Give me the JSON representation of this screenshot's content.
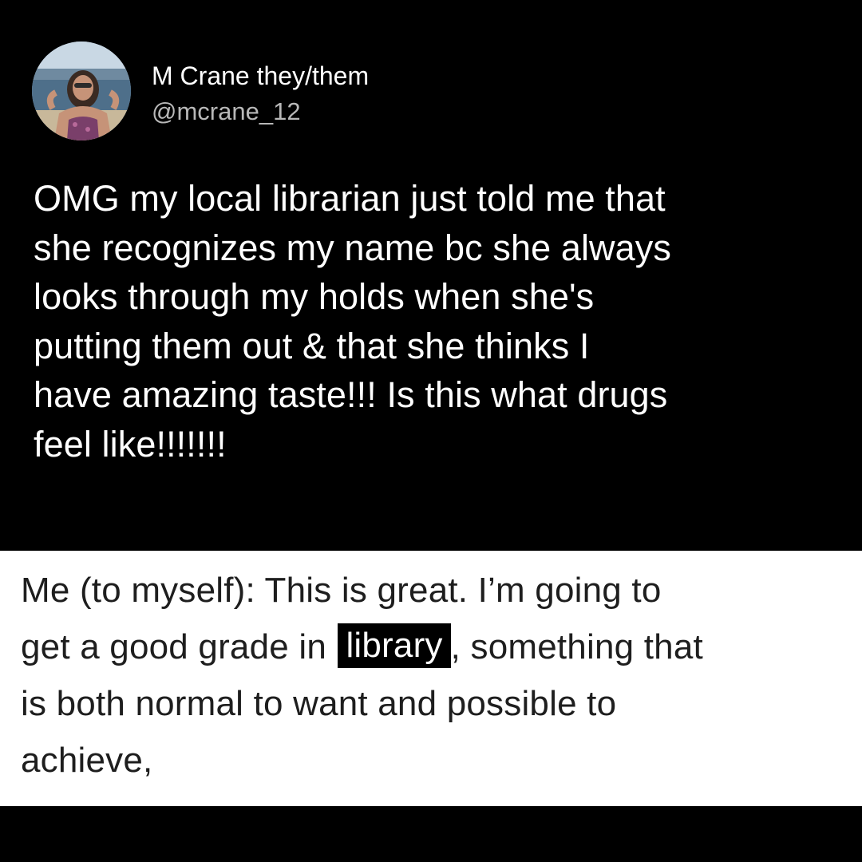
{
  "tweet": {
    "avatar_icon": "profile-photo",
    "display_name": "M Crane they/them",
    "handle": "@mcrane_12",
    "text_lines": [
      "OMG my local librarian just told me that",
      "she recognizes my name bc she always",
      "looks through my holds when she's",
      "putting them out & that she thinks I",
      "have amazing taste!!! Is this what drugs",
      "feel like!!!!!!!"
    ]
  },
  "quote": {
    "line1": "Me (to myself): This is great. I’m going to",
    "line2_before": "get a good grade in",
    "line2_highlight": "library",
    "line2_after": ", something that",
    "line3": "is both normal to want and possible to",
    "line4": "achieve,"
  },
  "colors": {
    "background": "#000000",
    "text_primary": "#ffffff",
    "handle": "#b8b8b8",
    "quote_background": "#ffffff",
    "quote_text": "#1e1e1e"
  }
}
